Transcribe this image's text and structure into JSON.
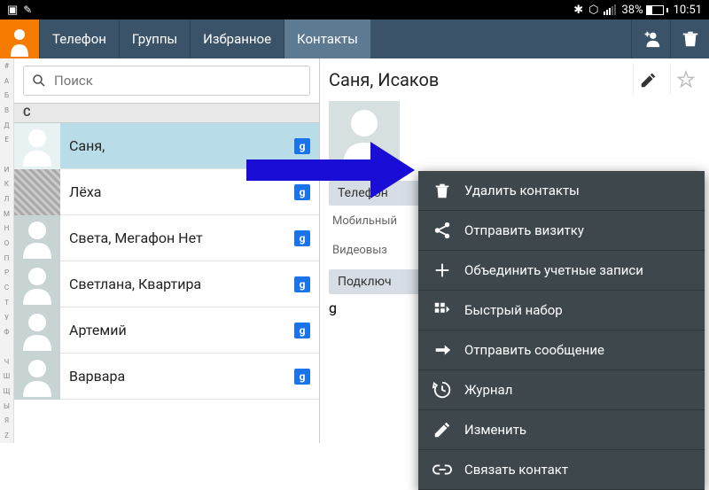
{
  "status": {
    "battery": "38%",
    "time": "10:51"
  },
  "tabs": {
    "t0": "Телефон",
    "t1": "Группы",
    "t2": "Избранное",
    "t3": "Контакты"
  },
  "search": {
    "placeholder": "Поиск"
  },
  "section_letter": "С",
  "contacts": {
    "c0": "Саня,",
    "c1": "Лёха",
    "c2": "Света, Мегафон Нет",
    "c3": "Светлана, Квартира",
    "c4": "Артемий",
    "c5": "Варвара"
  },
  "detail": {
    "name": "Саня, Исаков",
    "phone_hdr": "Телефон",
    "phone_label": "Мобильный",
    "video_hdr": "Видеовыз",
    "connect_hdr": "Подключ"
  },
  "menu": {
    "m0": "Удалить контакты",
    "m1": "Отправить визитку",
    "m2": "Объединить учетные записи",
    "m3": "Быстрый набор",
    "m4": "Отправить сообщение",
    "m5": "Журнал",
    "m6": "Изменить",
    "m7": "Связать контакт"
  },
  "index_letters": [
    "#",
    "А",
    "Б",
    "В",
    "Д",
    "Е",
    "",
    "И",
    "К",
    "Л",
    "М",
    "Н",
    "О",
    "П",
    "Р",
    "С",
    "Т",
    "У",
    "Ф",
    "",
    "Ч",
    "Ш",
    "Щ",
    "Ы",
    "Я",
    "Z"
  ]
}
